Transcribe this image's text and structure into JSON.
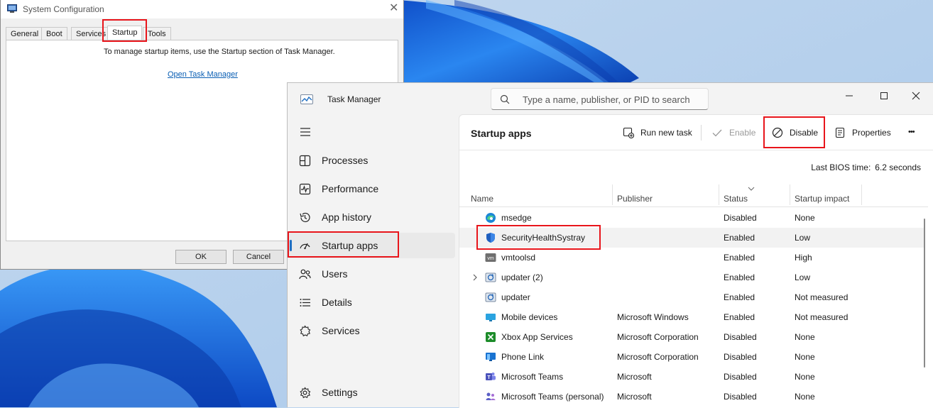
{
  "system_config": {
    "title": "System Configuration",
    "tabs": [
      "General",
      "Boot",
      "Services",
      "Startup",
      "Tools"
    ],
    "active_tab": "Startup",
    "info_text": "To manage startup items, use the Startup section of Task Manager.",
    "link_text": "Open Task Manager",
    "ok_label": "OK",
    "cancel_label": "Cancel",
    "close_glyph": "✕"
  },
  "task_manager": {
    "title": "Task Manager",
    "search_placeholder": "Type a name, publisher, or PID to search",
    "nav": [
      {
        "label": "Processes",
        "icon": "processes-icon"
      },
      {
        "label": "Performance",
        "icon": "performance-icon"
      },
      {
        "label": "App history",
        "icon": "app-history-icon"
      },
      {
        "label": "Startup apps",
        "icon": "startup-apps-icon",
        "selected": true
      },
      {
        "label": "Users",
        "icon": "users-icon"
      },
      {
        "label": "Details",
        "icon": "details-icon"
      },
      {
        "label": "Services",
        "icon": "services-icon"
      }
    ],
    "settings_label": "Settings",
    "section_title": "Startup apps",
    "toolbar": {
      "run_new_task": "Run new task",
      "enable": "Enable",
      "disable": "Disable",
      "properties": "Properties",
      "more": "•••"
    },
    "bios_label": "Last BIOS time:",
    "bios_value": "6.2 seconds",
    "columns": [
      "Name",
      "Publisher",
      "Status",
      "Startup impact"
    ],
    "rows": [
      {
        "name": "msedge",
        "publisher": "",
        "status": "Disabled",
        "impact": "None",
        "icon": "edge-icon"
      },
      {
        "name": "SecurityHealthSystray",
        "publisher": "",
        "status": "Enabled",
        "impact": "Low",
        "icon": "shield-icon",
        "selected": true
      },
      {
        "name": "vmtoolsd",
        "publisher": "",
        "status": "Enabled",
        "impact": "High",
        "icon": "vmware-icon"
      },
      {
        "name": "updater (2)",
        "publisher": "",
        "status": "Enabled",
        "impact": "Low",
        "icon": "updater-icon",
        "expandable": true
      },
      {
        "name": "updater",
        "publisher": "",
        "status": "Enabled",
        "impact": "Not measured",
        "icon": "updater-icon"
      },
      {
        "name": "Mobile devices",
        "publisher": "Microsoft Windows",
        "status": "Enabled",
        "impact": "Not measured",
        "icon": "mobile-devices-icon"
      },
      {
        "name": "Xbox App Services",
        "publisher": "Microsoft Corporation",
        "status": "Disabled",
        "impact": "None",
        "icon": "xbox-icon"
      },
      {
        "name": "Phone Link",
        "publisher": "Microsoft Corporation",
        "status": "Disabled",
        "impact": "None",
        "icon": "phone-link-icon"
      },
      {
        "name": "Microsoft Teams",
        "publisher": "Microsoft",
        "status": "Disabled",
        "impact": "None",
        "icon": "teams-icon"
      },
      {
        "name": "Microsoft Teams (personal)",
        "publisher": "Microsoft",
        "status": "Disabled",
        "impact": "None",
        "icon": "teams-personal-icon"
      }
    ]
  },
  "colors": {
    "highlight_box": "#e8151b",
    "accent": "#1f6fc3",
    "wallpaper_blue": "#1565e0"
  }
}
